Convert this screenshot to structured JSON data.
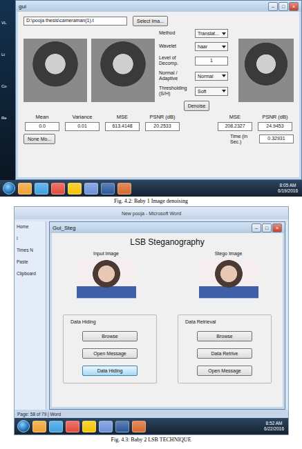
{
  "window_buttons": [
    "–",
    "□",
    "×"
  ],
  "figure1": {
    "desktop_labels": [
      "VL",
      "Lt",
      "Co",
      "Re"
    ],
    "window": {
      "title": "gui"
    },
    "path": "D:\\pooja thesis\\cameraman(1).t",
    "select_button": "Select Ima...",
    "controls": [
      {
        "label": "Method",
        "value": "Translat...",
        "kind": "dropdown"
      },
      {
        "label": "Wavelet",
        "value": "haar",
        "kind": "dropdown"
      },
      {
        "label": "Level of Decomp.",
        "value": "1",
        "kind": "field"
      },
      {
        "label": "Normal / Adaptive",
        "value": "Normal",
        "kind": "dropdown"
      },
      {
        "label": "Thresholding (S/H)",
        "value": "Soft",
        "kind": "dropdown"
      }
    ],
    "denoise_button": "Denoise",
    "noise_stats": [
      {
        "label": "Mean",
        "value": "0.0"
      },
      {
        "label": "Variance",
        "value": "0.01"
      },
      {
        "label": "MSE",
        "value": "613.4148"
      },
      {
        "label": "PSNR (dB)",
        "value": "20.2533"
      }
    ],
    "result_stats": [
      {
        "label": "MSE",
        "value": "208.2327"
      },
      {
        "label": "PSNR (dB)",
        "value": "24.9453"
      }
    ],
    "noise_button": "None Mo...",
    "time": {
      "label": "Time (in Sec.)",
      "value": "0.32931"
    },
    "taskbar": {
      "time": "8:05 AM",
      "date": "6/19/2016"
    }
  },
  "caption1": "Fig. 4.2: Baby 1 Image denoising",
  "figure2": {
    "word": {
      "title": "New pooja - Microsoft Word",
      "ribbon": [
        "Home",
        "I",
        "Times N",
        "Paste",
        "Clipboard"
      ],
      "status": "Page: 58 of 79 | Word"
    },
    "window": {
      "title": "Gui_Steg"
    },
    "heading": "LSB Steganography",
    "images": [
      {
        "label": "Input Image"
      },
      {
        "label": "Stego Image"
      }
    ],
    "panels": [
      {
        "title": "Data Hiding",
        "buttons": [
          {
            "label": "Browse",
            "selected": false
          },
          {
            "label": "Open Message",
            "selected": false
          },
          {
            "label": "Data Hiding",
            "selected": true
          }
        ]
      },
      {
        "title": "Data Retrieval",
        "buttons": [
          {
            "label": "Browse",
            "selected": false
          },
          {
            "label": "Data Retrive",
            "selected": false
          },
          {
            "label": "Open Message",
            "selected": false
          }
        ]
      }
    ],
    "taskbar": {
      "time": "8:52 AM",
      "date": "6/22/2016"
    }
  },
  "caption2": "Fig. 4.3: Baby 2 LSB TECHNIQUE"
}
